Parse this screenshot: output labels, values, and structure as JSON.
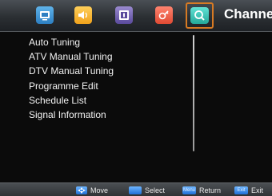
{
  "menu": {
    "title": "Channel",
    "active_tab": "channel",
    "accent_color": "#d77a24",
    "tabs": [
      {
        "id": "picture",
        "icon": "picture-icon"
      },
      {
        "id": "sound",
        "icon": "speaker-icon"
      },
      {
        "id": "time",
        "icon": "time-icon"
      },
      {
        "id": "lock",
        "icon": "lock-icon"
      },
      {
        "id": "channel",
        "icon": "search-icon"
      }
    ],
    "items": [
      "Auto Tuning",
      "ATV Manual Tuning",
      "DTV Manual Tuning",
      "Programme Edit",
      "Schedule List",
      "Signal Information"
    ]
  },
  "hints": {
    "move": {
      "key_icon": "dpad-icon",
      "label": "Move"
    },
    "select": {
      "key_icon": "ok-key-icon",
      "label": "Select"
    },
    "return": {
      "key": "Menu",
      "label": "Return"
    },
    "exit": {
      "key": "Exit",
      "label": "Exit"
    }
  }
}
